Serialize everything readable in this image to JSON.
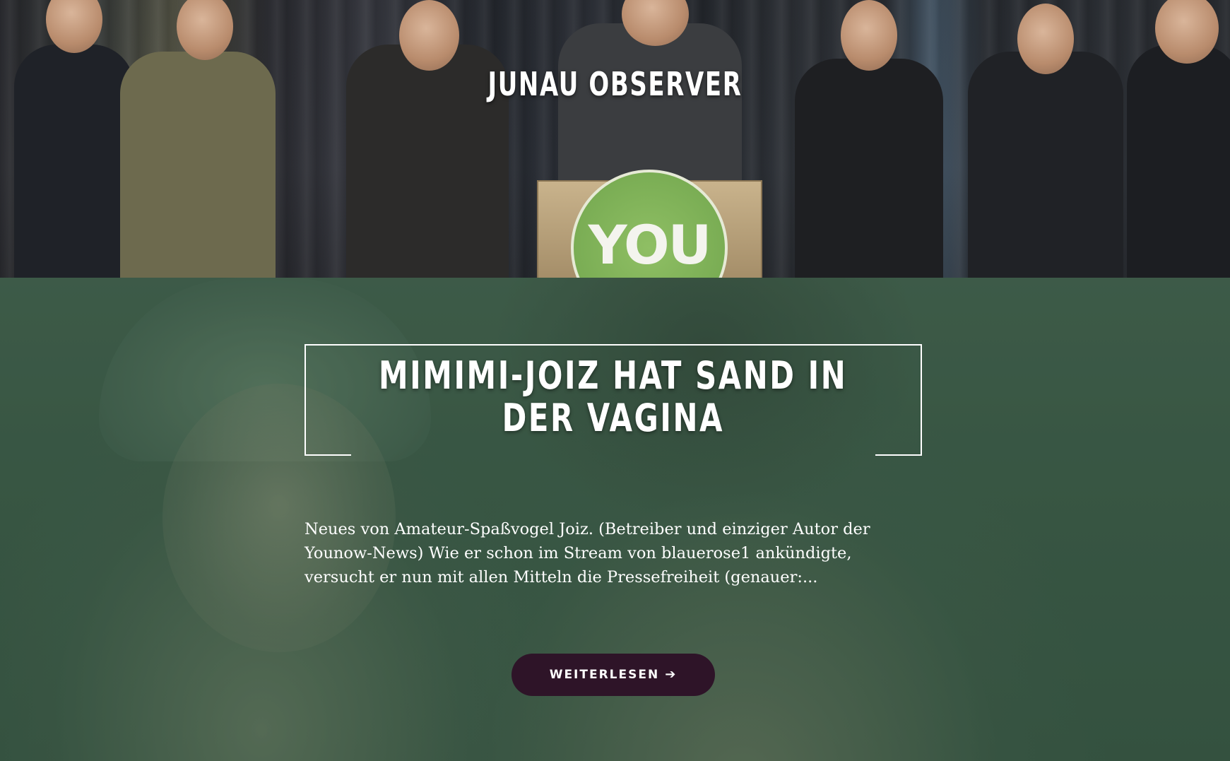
{
  "header": {
    "site_title": "JUNAU OBSERVER",
    "image_logo_text": "YOU"
  },
  "featured_post": {
    "title_line_1": "MIMIMI-JOIZ HAT SAND IN",
    "title_line_2": "DER VAGINA",
    "excerpt": "Neues von Amateur-Spaßvogel Joiz. (Betreiber und einziger Autor der Younow-News) Wie er schon im Stream von blauerose1 ankündigte, versucht er nun mit allen Mitteln die Pressefreiheit (genauer:...",
    "read_more_label": "WEITERLESEN",
    "read_more_icon": "arrow-right-icon"
  },
  "colors": {
    "button_bg": "#2e1428",
    "hero_tint": "#3f5d48",
    "text": "#ffffff"
  }
}
